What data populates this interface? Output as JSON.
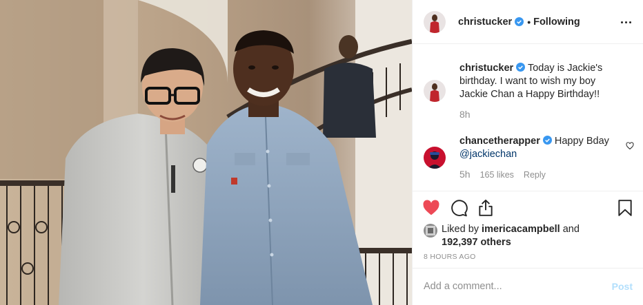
{
  "post": {
    "author": "christucker",
    "follow_state": "Following",
    "separator": "•",
    "caption": {
      "username": "christucker",
      "text": "Today is Jackie's birthday. I want to wish my boy Jackie Chan a Happy Birthday!!",
      "time": "8h"
    },
    "comments": [
      {
        "username": "chancetherapper",
        "text_prefix": "Happy Bday ",
        "mention": "@jackiechan",
        "time": "5h",
        "likes": "165 likes",
        "reply_label": "Reply"
      }
    ],
    "liked_by": {
      "prefix": "Liked by ",
      "user": "imericacampbell",
      "and": " and",
      "others": "192,397 others"
    },
    "timestamp": "8 HOURS AGO",
    "add_comment_placeholder": "Add a comment...",
    "post_button": "Post"
  },
  "colors": {
    "heart_liked": "#ed4956",
    "verified": "#3897f0",
    "post_disabled": "#b2dffc",
    "muted": "#8e8e8e"
  },
  "icons": {
    "header": [
      "verified-badge-icon",
      "more-options-icon"
    ],
    "actions": [
      "heart-filled-icon",
      "comment-icon",
      "share-icon",
      "bookmark-icon"
    ],
    "comment": [
      "heart-outline-icon"
    ]
  }
}
